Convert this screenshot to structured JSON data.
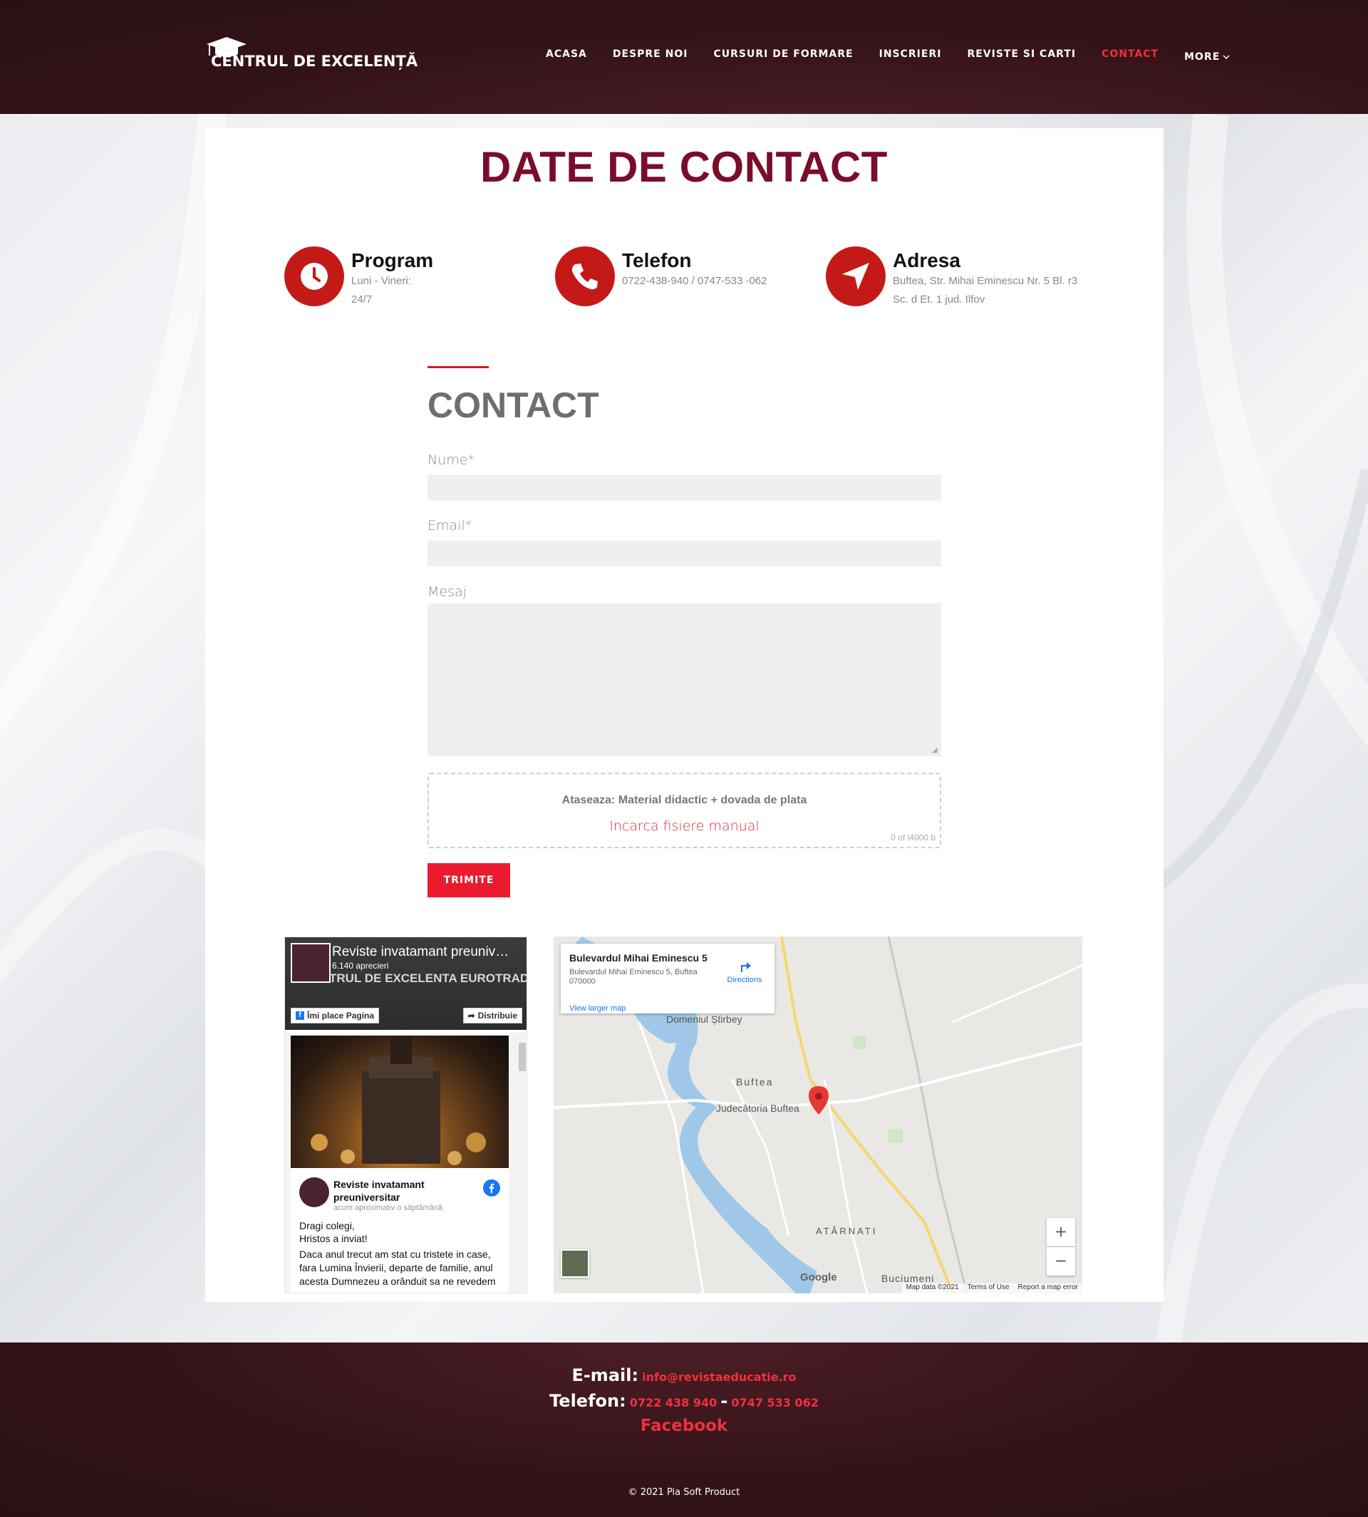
{
  "header": {
    "logo_text": "CENTRUL DE EXCELENȚĂ",
    "nav": [
      {
        "label": "ACASA",
        "active": false
      },
      {
        "label": "DESPRE NOI",
        "active": false
      },
      {
        "label": "CURSURI DE FORMARE",
        "active": false
      },
      {
        "label": "INSCRIERI",
        "active": false
      },
      {
        "label": "REVISTE SI CARTI",
        "active": false
      },
      {
        "label": "CONTACT",
        "active": true
      },
      {
        "label": "MORE",
        "active": false
      }
    ]
  },
  "page_title": "DATE DE CONTACT",
  "info": {
    "program": {
      "title": "Program",
      "line1": "Luni - Vineri:",
      "line2": "24/7",
      "icon": "clock-icon"
    },
    "telefon": {
      "title": "Telefon",
      "line1": "0722-438-940 / 0747-533 -062",
      "icon": "phone-icon"
    },
    "adresa": {
      "title": "Adresa",
      "line1": "Buftea, Str. Mihai Eminescu Nr. 5 Bl. r3",
      "line2": "Sc. d Et. 1 jud. Ilfov",
      "icon": "location-arrow-icon"
    }
  },
  "form": {
    "heading": "CONTACT",
    "name_label": "Nume*",
    "name_value": "",
    "email_label": "Email*",
    "email_value": "",
    "message_label": "Mesaj",
    "message_value": "",
    "upload_title": "Ataseaza: Material didactic + dovada de plata",
    "upload_link": "Incarca fisiere manual",
    "upload_count": "0 of l4000 b",
    "submit_label": "TRIMITE"
  },
  "facebook": {
    "page_name": "Reviste invatamant preuniv…",
    "likes": "6.140 aprecieri",
    "cover_text": "TRUL DE EXCELENTA EUROTRADING",
    "like_button": "Îmi place Pagina",
    "share_button": "Distribuie",
    "post_author": "Reviste invatamant preuniversitar",
    "post_time": "acum aproximativ o săptămână",
    "post_lines": [
      "Dragi colegi,",
      "Hristos a inviat!",
      "Daca anul trecut am stat cu tristete in case,",
      "fara Lumina Învierii, departe de familie, anul",
      "acesta Dumnezeu a orânduit sa ne revedem"
    ]
  },
  "map": {
    "place_title": "Bulevardul Mihai Eminescu 5",
    "place_address": "Bulevardul Mihai Eminescu 5, Buftea 070000",
    "directions": "Directions",
    "larger_map": "View larger map",
    "labels": {
      "domeniul": "Domeniul Știrbey",
      "buftea": "Buftea",
      "judecatoria": "Judecătoria Buftea",
      "atarnati": "ATÂRNATI",
      "buciumeni": "Buciumeni"
    },
    "footer": {
      "data": "Map data ©2021",
      "terms": "Terms of Use",
      "report": "Report a map error"
    },
    "google": "Google",
    "zoom_in": "+",
    "zoom_out": "−"
  },
  "footer": {
    "email_label": "E-mail:",
    "email": "info@revistaeducatie.ro",
    "phone_label": "Telefon:",
    "phone1": "0722 438 940",
    "phone_sep": "-",
    "phone2": "0747 533 062",
    "facebook": "Facebook",
    "copyright": "© 2021 Pia Soft Product"
  },
  "colors": {
    "accent": "#ea1b2e",
    "title": "#7a0d2a",
    "icon_circle": "#c41a17",
    "header_bg": "#331318"
  }
}
